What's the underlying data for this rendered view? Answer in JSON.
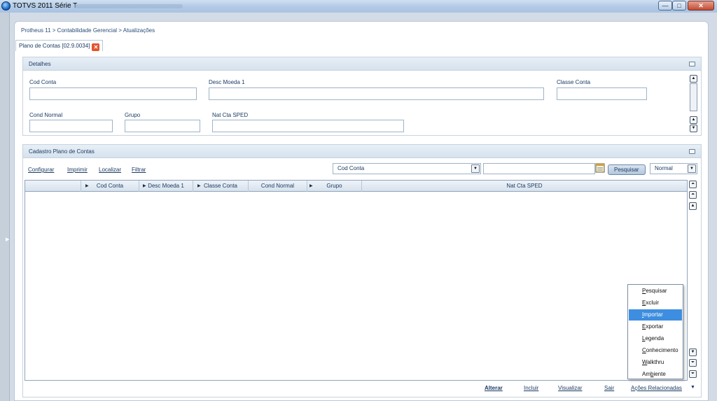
{
  "window": {
    "title": "TOTVS 2011 Série T",
    "min_glyph": "—",
    "max_glyph": "□",
    "close_glyph": "✕"
  },
  "breadcrumb": "Protheus 11 > Contabilidade Gerencial > Atualizações",
  "tab": {
    "label": "Plano de Contas [02.9.0034]",
    "close_glyph": "✕"
  },
  "details": {
    "title": "Detalhes",
    "fields": {
      "cod_conta": "Cod Conta",
      "desc_moeda": "Desc Moeda 1",
      "classe_conta": "Classe Conta",
      "cond_normal": "Cond Normal",
      "grupo": "Grupo",
      "nat_cta": "Nat Cta SPED"
    }
  },
  "cadastro": {
    "title": "Cadastro Plano de Contas",
    "links": {
      "configurar": "Configurar",
      "imprimir": "Imprimir",
      "localizar": "Localizar",
      "filtrar": "Filtrar"
    },
    "search_field": "Cod Conta",
    "search_value": "",
    "search_button": "Pesquisar",
    "search_mode": "Normal",
    "columns": [
      "Cod Conta",
      "Desc Moeda 1",
      "Classe Conta",
      "Cond Normal",
      "Grupo",
      "Nat Cta SPED"
    ]
  },
  "context_menu": {
    "items": [
      {
        "key": "P",
        "rest": "esquisar"
      },
      {
        "key": "E",
        "rest": "xcluir"
      },
      {
        "key": "I",
        "rest": "mportar"
      },
      {
        "key": "E",
        "rest": "xportar"
      },
      {
        "key": "L",
        "rest": "egenda"
      },
      {
        "key": "C",
        "rest": "onhecimento"
      },
      {
        "key": "W",
        "rest": "alkthru"
      },
      {
        "pre": "Am",
        "key": "b",
        "rest": "iente"
      }
    ],
    "active_index": 2
  },
  "footer": {
    "alterar": "Alterar",
    "incluir": "Incluir",
    "visualizar": "Visualizar",
    "sair": "Sair",
    "acoes": "Ações Relacionadas"
  },
  "colors": {
    "accent": "#3d8ee0",
    "close_red": "#e2552d"
  }
}
